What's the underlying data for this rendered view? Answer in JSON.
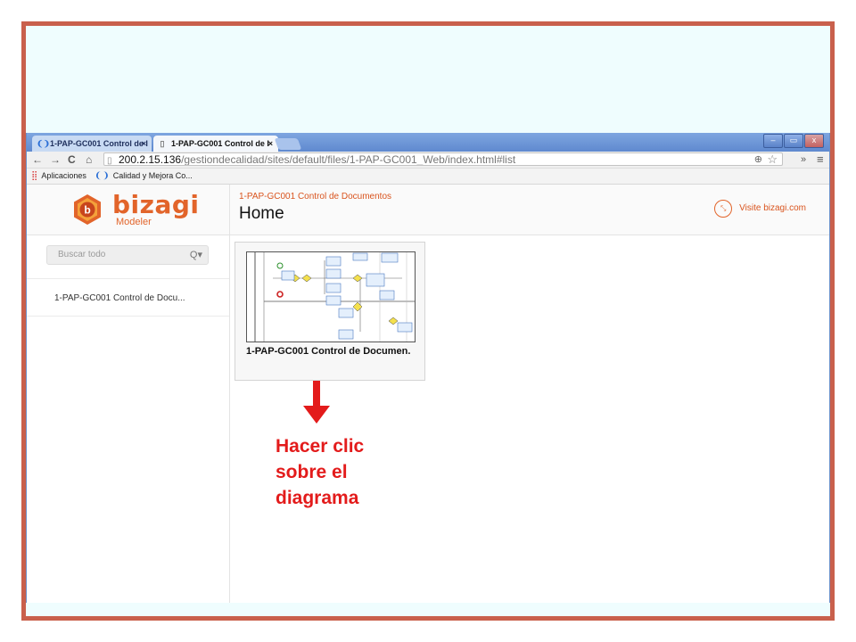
{
  "browser": {
    "tabs": [
      {
        "label": "1-PAP-GC001 Control de I",
        "close": "×",
        "active": false
      },
      {
        "label": "1-PAP-GC001 Control de I",
        "close": "×",
        "active": true
      }
    ],
    "window_buttons": {
      "minimize": "–",
      "maximize": "▭",
      "close": "x"
    },
    "nav": {
      "back": "←",
      "forward": "→",
      "reload": "C",
      "home": "⌂"
    },
    "url": {
      "host": "200.2.15.136",
      "path": "/gestiondecalidad/sites/default/files/1-PAP-GC001_Web/index.html#list"
    },
    "toolbar_right": {
      "extend": "»",
      "menu": "≡"
    },
    "bookmarks": [
      {
        "label": "Aplicaciones",
        "icon": "apps-grid-icon"
      },
      {
        "label": "Calidad y Mejora Co...",
        "icon": "bizagi-leaf-icon"
      }
    ]
  },
  "app": {
    "logo_text": "bizagi",
    "logo_sub": "Modeler",
    "process_name": "1-PAP-GC001 Control de Documentos",
    "page_title": "Home",
    "visit_link": "Visite bizagi.com",
    "search": {
      "placeholder": "Buscar todo",
      "icon": "Q▾"
    },
    "sidebar_items": [
      "1-PAP-GC001 Control de Docu..."
    ],
    "diagram_card": {
      "label": "1-PAP-GC001 Control de Documen."
    }
  },
  "annotation": {
    "lines": [
      "Hacer clic",
      "sobre el",
      "diagrama"
    ],
    "color": "#e31b1b"
  },
  "colors": {
    "frame": "#c9604c",
    "frame_bg": "#effdfe",
    "brand": "#e2642a"
  }
}
